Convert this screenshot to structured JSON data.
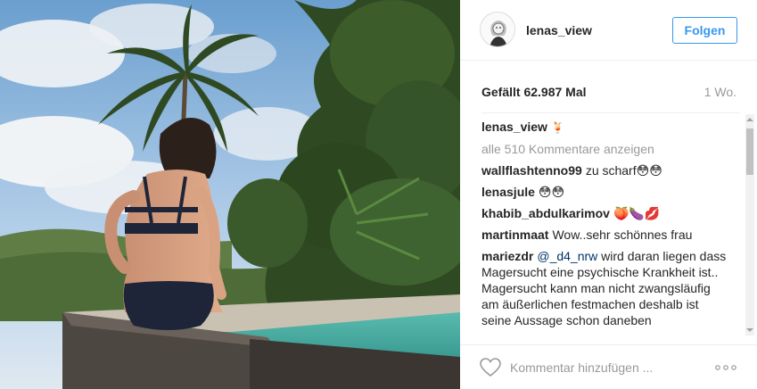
{
  "post": {
    "photo_alt": "",
    "photo_icon": "photo-icon"
  },
  "header": {
    "username": "lenas_view",
    "follow_label": "Folgen",
    "avatar_icon": "avatar-icon"
  },
  "stats": {
    "likes": "Gefällt 62.987 Mal",
    "time": "1 Wo."
  },
  "comments": {
    "caption_user": "lenas_view",
    "caption_text": "🍹",
    "load_more": "alle 510 Kommentare anzeigen",
    "items": [
      {
        "user": "wallflashtenno99",
        "text": "zu scharf😳😳"
      },
      {
        "user": "lenasjule",
        "text": "😳😳"
      },
      {
        "user": "khabib_abdulkarimov",
        "text": "🍑🍆💋"
      },
      {
        "user": "martinmaat",
        "text": "Wow..sehr schönnes frau"
      },
      {
        "user": "mariezdr",
        "mention": "@_d4_nrw",
        "text": " wird daran liegen dass Magersucht eine psychische Krankheit ist.. Magersucht kann man nicht zwangsläufig am äußerlichen festmachen deshalb ist seine Aussage schon daneben"
      }
    ]
  },
  "footer": {
    "comment_placeholder": "Kommentar hinzufügen ...",
    "like_icon": "heart-icon",
    "more_label": "ooo"
  },
  "colors": {
    "accent": "#3897f0",
    "text": "#262626",
    "muted": "#999999",
    "border": "#efefef"
  }
}
